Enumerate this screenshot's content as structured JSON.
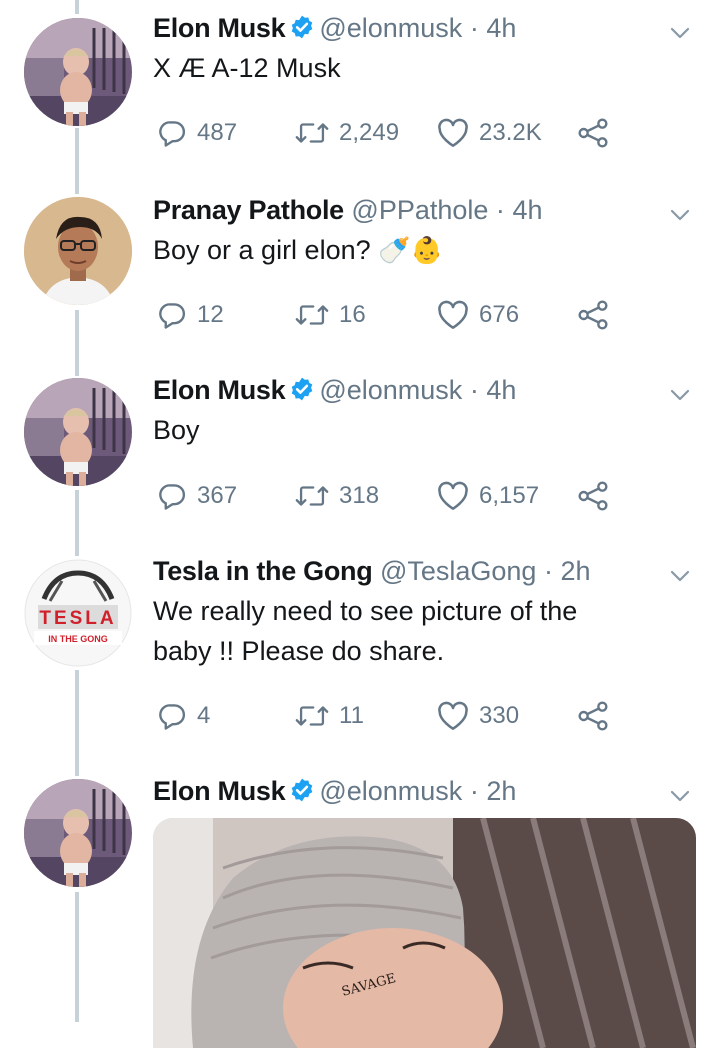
{
  "tweets": [
    {
      "name": "Elon Musk",
      "verified": true,
      "handle": "@elonmusk",
      "dot": "·",
      "time": "4h",
      "text": "X Æ A-12 Musk",
      "replies": "487",
      "retweets": "2,249",
      "likes": "23.2K",
      "avatar": "baby-photo-avatar"
    },
    {
      "name": "Pranay Pathole",
      "verified": false,
      "handle": "@PPathole",
      "dot": "·",
      "time": "4h",
      "text": "Boy or a girl elon?",
      "emoji": "🍼👶",
      "replies": "12",
      "retweets": "16",
      "likes": "676",
      "avatar": "person-photo-avatar"
    },
    {
      "name": "Elon Musk",
      "verified": true,
      "handle": "@elonmusk",
      "dot": "·",
      "time": "4h",
      "text": "Boy",
      "replies": "367",
      "retweets": "318",
      "likes": "6,157",
      "avatar": "baby-photo-avatar"
    },
    {
      "name": "Tesla in the Gong",
      "verified": false,
      "handle": "@TeslaGong",
      "dot": "·",
      "time": "2h",
      "text_line1": "We really need to see picture of the",
      "text_line2": "baby !! Please do share.",
      "replies": "4",
      "retweets": "11",
      "likes": "330",
      "avatar": "tesla-gong-logo-avatar",
      "logo_text_top": "TESLA",
      "logo_text_bottom": "IN THE GONG"
    },
    {
      "name": "Elon Musk",
      "verified": true,
      "handle": "@elonmusk",
      "dot": "·",
      "time": "2h",
      "media": "newborn-baby-photo",
      "media_caption": "SAVAGE",
      "avatar": "baby-photo-avatar"
    }
  ],
  "colors": {
    "text": "#14171a",
    "secondary": "#657786",
    "verified": "#1da1f2",
    "thread_line": "#c7d1d8"
  }
}
